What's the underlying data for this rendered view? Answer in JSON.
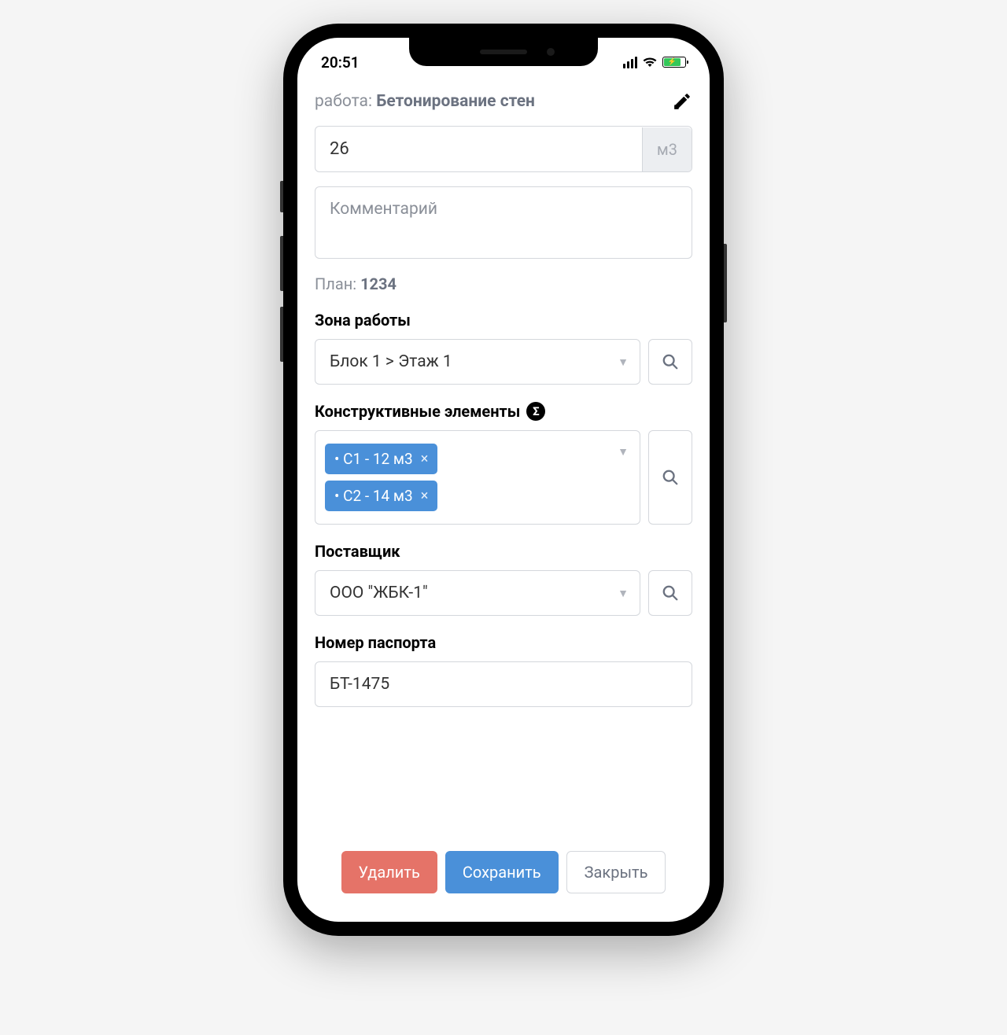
{
  "status": {
    "time": "20:51"
  },
  "header": {
    "label": "работа:",
    "value": "Бетонирование стен"
  },
  "quantity": {
    "value": "26",
    "unit": "м3"
  },
  "comment": {
    "placeholder": "Комментарий"
  },
  "plan": {
    "label": "План:",
    "value": "1234"
  },
  "zone": {
    "label": "Зона работы",
    "selected": "Блок 1 > Этаж 1"
  },
  "elements": {
    "label": "Конструктивные элементы",
    "sigma": "Σ",
    "tags": [
      "• С1 - 12 м3",
      "• С2 - 14 м3"
    ]
  },
  "supplier": {
    "label": "Поставщик",
    "selected": "ООО \"ЖБК-1\""
  },
  "passport": {
    "label": "Номер паспорта",
    "value": "БТ-1475"
  },
  "buttons": {
    "delete": "Удалить",
    "save": "Сохранить",
    "close": "Закрыть"
  }
}
